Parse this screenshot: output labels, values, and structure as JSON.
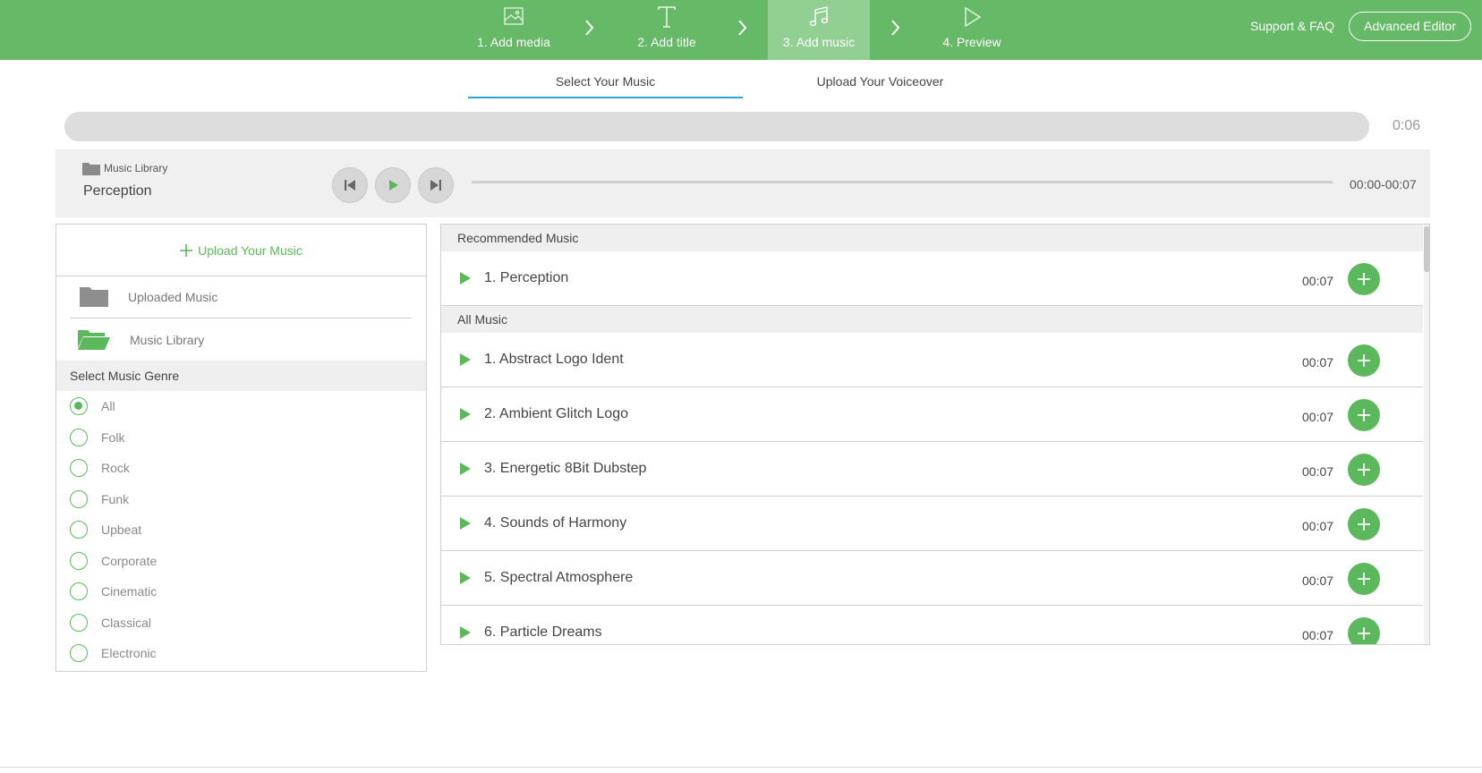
{
  "header": {
    "steps": [
      {
        "label": "1. Add media",
        "icon": "image-icon",
        "active": false
      },
      {
        "label": "2. Add title",
        "icon": "text-icon",
        "active": false
      },
      {
        "label": "3. Add music",
        "icon": "music-icon",
        "active": true
      },
      {
        "label": "4. Preview",
        "icon": "play-outline-icon",
        "active": false
      }
    ],
    "support_label": "Support & FAQ",
    "advanced_editor_label": "Advanced Editor"
  },
  "tabs": [
    {
      "label": "Select Your Music",
      "active": true
    },
    {
      "label": "Upload Your Voiceover",
      "active": false
    }
  ],
  "progress": {
    "time": "0:06"
  },
  "player": {
    "source_label": "Music Library",
    "track_name": "Perception",
    "time_range": "00:00-00:07"
  },
  "left_panel": {
    "upload_label": "Upload Your Music",
    "folders": [
      {
        "label": "Uploaded Music",
        "icon": "folder-icon"
      },
      {
        "label": "Music Library",
        "icon": "folder-open-icon"
      }
    ],
    "genre_heading": "Select Music Genre",
    "genres": [
      {
        "label": "All",
        "selected": true
      },
      {
        "label": "Folk",
        "selected": false
      },
      {
        "label": "Rock",
        "selected": false
      },
      {
        "label": "Funk",
        "selected": false
      },
      {
        "label": "Upbeat",
        "selected": false
      },
      {
        "label": "Corporate",
        "selected": false
      },
      {
        "label": "Cinematic",
        "selected": false
      },
      {
        "label": "Classical",
        "selected": false
      },
      {
        "label": "Electronic",
        "selected": false
      }
    ]
  },
  "music": {
    "recommended_heading": "Recommended Music",
    "recommended": [
      {
        "name": "1. Perception",
        "duration": "00:07"
      }
    ],
    "all_heading": "All Music",
    "all": [
      {
        "name": "1. Abstract Logo Ident",
        "duration": "00:07"
      },
      {
        "name": "2. Ambient Glitch Logo",
        "duration": "00:07"
      },
      {
        "name": "3. Energetic 8Bit Dubstep",
        "duration": "00:07"
      },
      {
        "name": "4. Sounds of Harmony",
        "duration": "00:07"
      },
      {
        "name": "5. Spectral Atmosphere",
        "duration": "00:07"
      },
      {
        "name": "6. Particle Dreams",
        "duration": "00:07"
      }
    ]
  },
  "colors": {
    "brand_green": "#66b966",
    "accent_green": "#5cb85c",
    "tab_underline": "#2aa6d6"
  }
}
